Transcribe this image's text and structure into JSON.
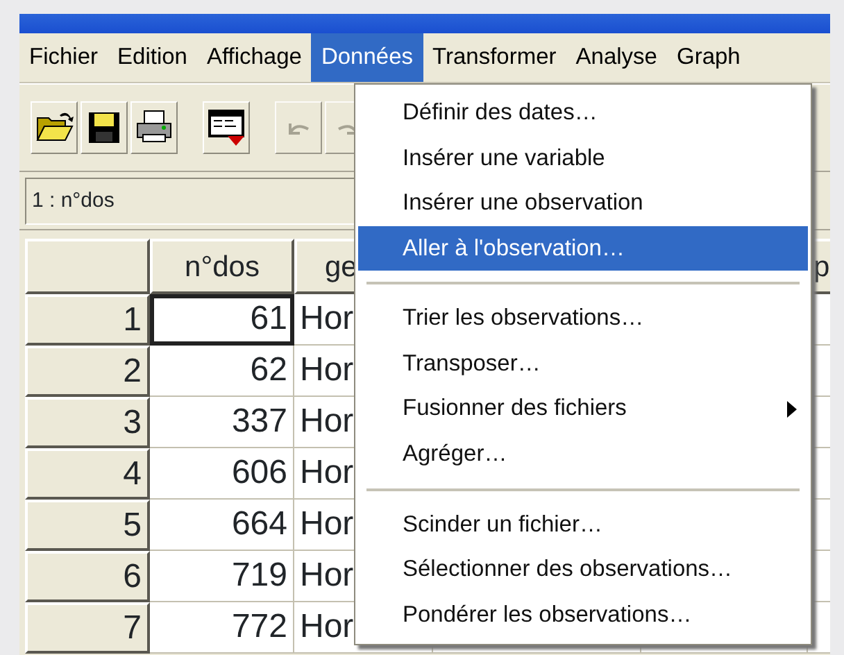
{
  "menubar": [
    {
      "label": "Fichier",
      "selected": false
    },
    {
      "label": "Edition",
      "selected": false
    },
    {
      "label": "Affichage",
      "selected": false
    },
    {
      "label": "Données",
      "selected": true
    },
    {
      "label": "Transformer",
      "selected": false
    },
    {
      "label": "Analyse",
      "selected": false
    },
    {
      "label": "Graph",
      "selected": false
    }
  ],
  "toolbar": [
    {
      "kind": "open",
      "disabled": false
    },
    {
      "kind": "save",
      "disabled": false
    },
    {
      "kind": "print",
      "disabled": false
    },
    {
      "kind": "dialog",
      "disabled": false
    },
    {
      "kind": "undo",
      "disabled": true
    },
    {
      "kind": "redo",
      "disabled": true
    }
  ],
  "cell_editor": {
    "text": "1 : n°dos"
  },
  "table": {
    "columns": [
      "n°dos",
      "ge",
      "",
      "",
      "p"
    ],
    "rows": [
      {
        "header": "1",
        "cells": [
          "61",
          "Hor"
        ],
        "selected": true
      },
      {
        "header": "2",
        "cells": [
          "62",
          "Hor"
        ],
        "selected": false
      },
      {
        "header": "3",
        "cells": [
          "337",
          "Hor"
        ],
        "selected": false
      },
      {
        "header": "4",
        "cells": [
          "606",
          "Hor"
        ],
        "selected": false
      },
      {
        "header": "5",
        "cells": [
          "664",
          "Hor"
        ],
        "selected": false
      },
      {
        "header": "6",
        "cells": [
          "719",
          "Hor"
        ],
        "selected": false
      },
      {
        "header": "7",
        "cells": [
          "772",
          "Hor"
        ],
        "selected": false
      }
    ]
  },
  "menu": {
    "items": [
      {
        "kind": "item",
        "label": "Définir des dates…",
        "selected": false
      },
      {
        "kind": "item",
        "label": "Insérer une variable",
        "selected": false
      },
      {
        "kind": "item",
        "label": "Insérer une observation",
        "selected": false
      },
      {
        "kind": "item",
        "label": "Aller à l'observation…",
        "selected": true
      },
      {
        "kind": "separator"
      },
      {
        "kind": "item",
        "label": "Trier les observations…",
        "selected": false
      },
      {
        "kind": "item",
        "label": "Transposer…",
        "selected": false
      },
      {
        "kind": "item",
        "label": "Fusionner des fichiers",
        "selected": false,
        "submenu": true
      },
      {
        "kind": "item",
        "label": "Agréger…",
        "selected": false
      },
      {
        "kind": "separator"
      },
      {
        "kind": "item",
        "label": "Scinder un fichier…",
        "selected": false
      },
      {
        "kind": "item",
        "label": "Sélectionner des observations…",
        "selected": false
      },
      {
        "kind": "item",
        "label": "Pondérer les observations…",
        "selected": false
      }
    ]
  }
}
